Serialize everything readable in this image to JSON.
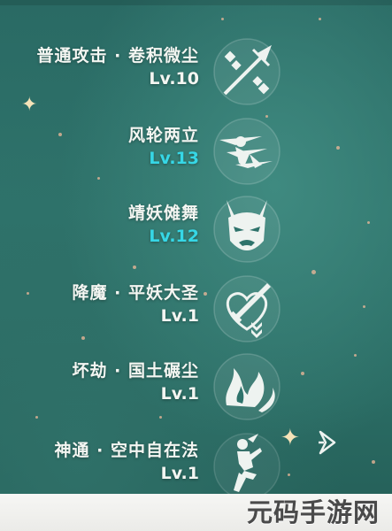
{
  "talents": [
    {
      "name": "普通攻击 · 卷积微尘",
      "level": "Lv.10",
      "level_color": "#f4f6f2",
      "icon": "spear-attack-icon"
    },
    {
      "name": "风轮两立",
      "level": "Lv.13",
      "level_color": "#36d7e6",
      "icon": "wind-dash-icon"
    },
    {
      "name": "靖妖傩舞",
      "level": "Lv.12",
      "level_color": "#36d7e6",
      "icon": "yaksha-mask-icon"
    },
    {
      "name": "降魔 · 平妖大圣",
      "level": "Lv.1",
      "level_color": "#f4f6f2",
      "icon": "sword-heart-icon"
    },
    {
      "name": "坏劫 · 国土碾尘",
      "level": "Lv.1",
      "level_color": "#f4f6f2",
      "icon": "wind-flame-icon"
    },
    {
      "name": "神通 · 空中自在法",
      "level": "Lv.1",
      "level_color": "#f4f6f2",
      "icon": "leaping-figure-icon"
    }
  ],
  "footer": {
    "watermark": "元码手游网"
  },
  "colors": {
    "background": "#2e736b",
    "text": "#f4f6f2",
    "boosted_level": "#36d7e6"
  }
}
